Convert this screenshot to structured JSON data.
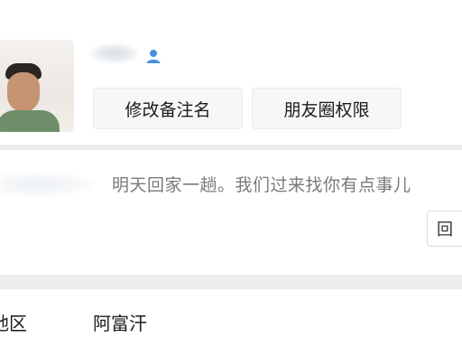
{
  "profile": {
    "remark_button_label": "修改备注名",
    "moments_button_label": "朋友圈权限",
    "profile_icon": "person-icon",
    "avatar_icon": "avatar-photo"
  },
  "message": {
    "text": "明天回家一趟。我们过来找你有点事儿",
    "action_button_label": "回"
  },
  "region": {
    "label": "地区",
    "value": "阿富汗"
  },
  "colors": {
    "accent": "#4a90e2",
    "background": "#ededed",
    "card": "#ffffff"
  }
}
